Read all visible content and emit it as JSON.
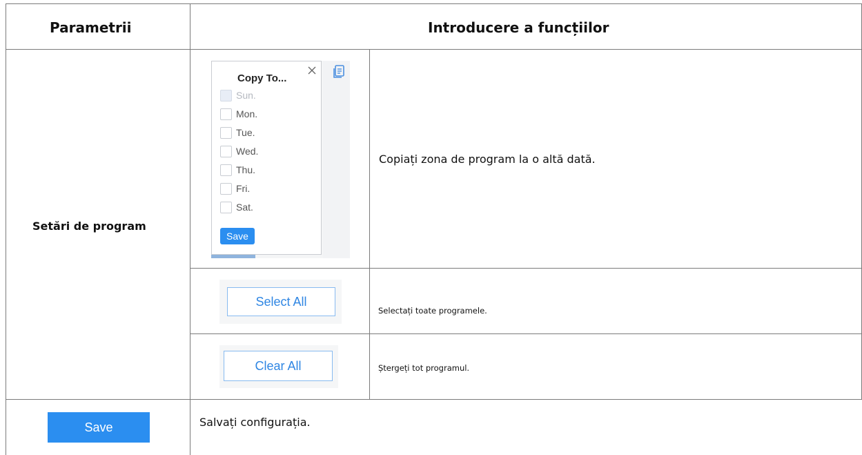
{
  "header": {
    "col1": "Parametrii",
    "col2": "Introducere a funcțiilor"
  },
  "rows": {
    "schedule_label": "Setări de program",
    "copy": {
      "title": "Copy To...",
      "days": [
        "Sun.",
        "Mon.",
        "Tue.",
        "Wed.",
        "Thu.",
        "Fri.",
        "Sat."
      ],
      "save_label": "Save",
      "description": "Copiați zona de program la o altă dată.",
      "icons": [
        "close-icon",
        "copy-icon"
      ]
    },
    "select_all": {
      "label": "Select All",
      "description": "Selectați toate programele."
    },
    "clear_all": {
      "label": "Clear All",
      "description": "Ștergeți tot programul."
    },
    "save": {
      "label": "Save",
      "description": "Salvați configurația."
    }
  },
  "colors": {
    "accent": "#2b8ef0",
    "outline_button_text": "#2f86e3",
    "border": "#7a7a7a"
  }
}
